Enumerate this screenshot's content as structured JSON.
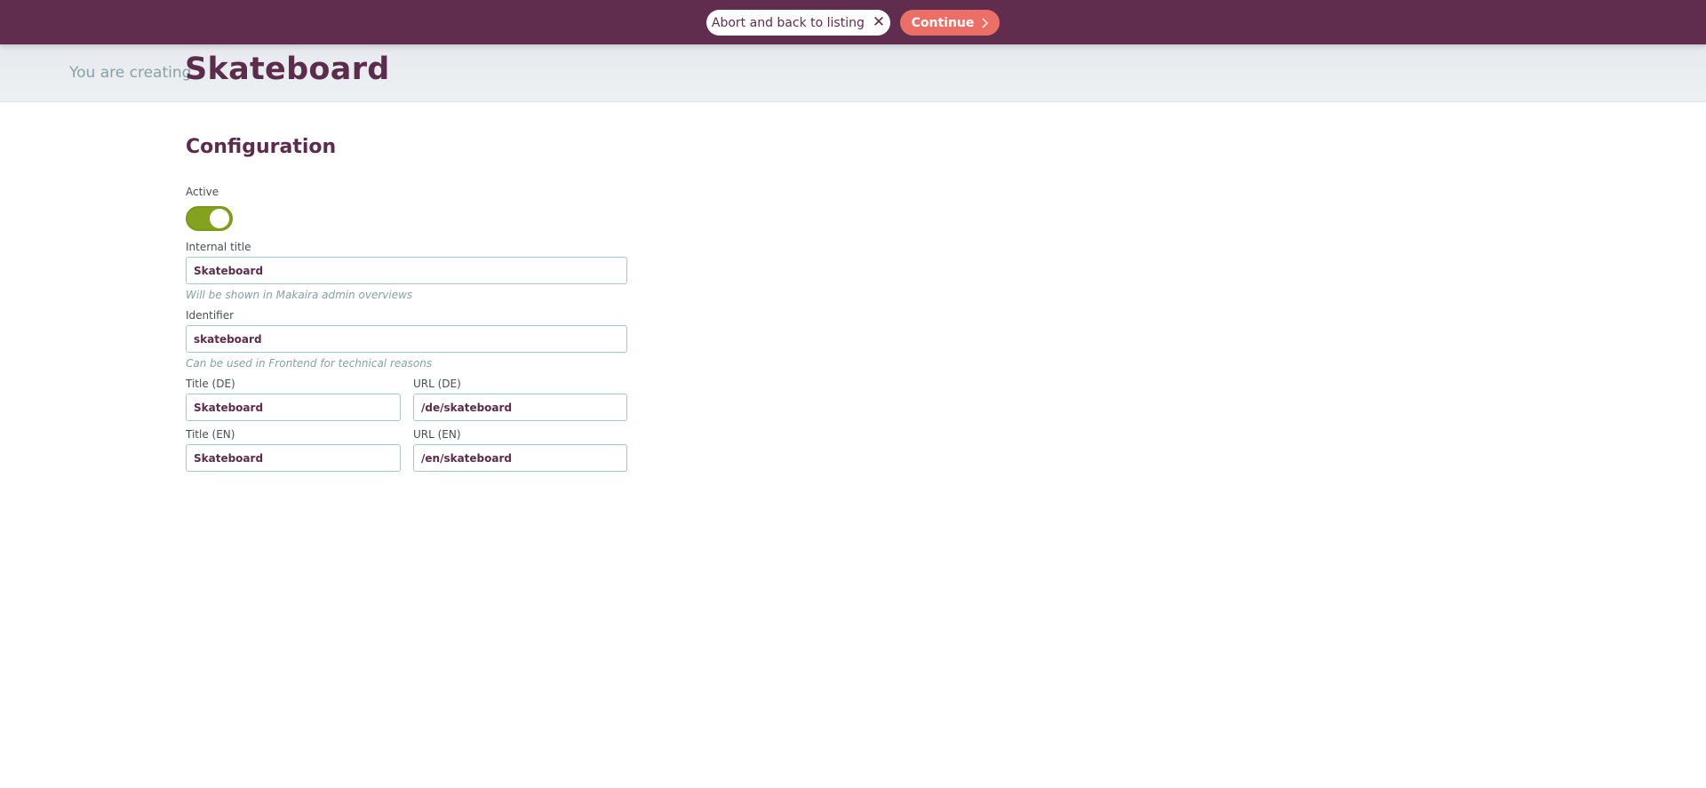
{
  "topbar": {
    "abort_label": "Abort and back to listing",
    "continue_label": "Continue"
  },
  "header": {
    "prefix": "You are creating",
    "title": "Skateboard"
  },
  "form": {
    "section_title": "Configuration",
    "active": {
      "label": "Active",
      "value": true
    },
    "internal_title": {
      "label": "Internal title",
      "value": "Skateboard",
      "hint": "Will be shown in Makaira admin overviews"
    },
    "identifier": {
      "label": "Identifier",
      "value": "skateboard",
      "hint": "Can be used in Frontend for technical reasons"
    },
    "title_de": {
      "label": "Title (DE)",
      "value": "Skateboard"
    },
    "url_de": {
      "label": "URL (DE)",
      "value": "/de/skateboard"
    },
    "title_en": {
      "label": "Title (EN)",
      "value": "Skateboard"
    },
    "url_en": {
      "label": "URL (EN)",
      "value": "/en/skateboard"
    }
  },
  "colors": {
    "topbar": "#602d4e",
    "primary_text": "#5b2c4b",
    "continue_button": "#eb6f66",
    "toggle_on": "#84a21e",
    "input_border": "#a9c7c8",
    "hint_text": "#86a0a6"
  },
  "icons": {
    "abort": "close-icon",
    "continue": "chevron-right-icon"
  }
}
